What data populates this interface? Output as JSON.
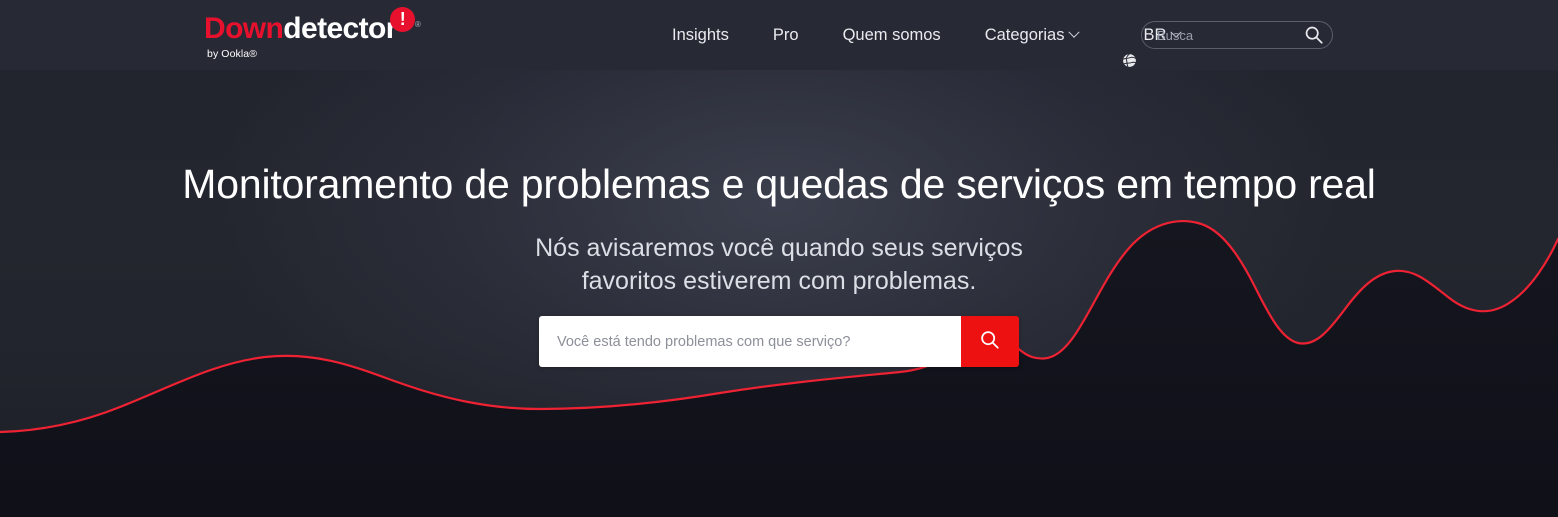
{
  "header": {
    "logo": {
      "word_one": "Down",
      "word_two": "detector",
      "badge_glyph": "!",
      "registered_mark": "®",
      "tagline": "by Ookla®"
    },
    "nav": [
      {
        "label": "Insights",
        "has_chevron": false,
        "has_globe": false
      },
      {
        "label": "Pro",
        "has_chevron": false,
        "has_globe": false
      },
      {
        "label": "Quem somos",
        "has_chevron": false,
        "has_globe": false
      },
      {
        "label": "Categorias",
        "has_chevron": true,
        "has_globe": false
      },
      {
        "label": "BR",
        "has_chevron": true,
        "has_globe": true
      }
    ],
    "search": {
      "value": "",
      "placeholder": "Busca",
      "icon": "search-icon"
    }
  },
  "hero": {
    "title": "Monitoramento de problemas e quedas de serviços em tempo real",
    "subtitle_line_1": "Nós avisaremos você quando seus serviços",
    "subtitle_line_2": "favoritos estiverem com problemas.",
    "search": {
      "value": "",
      "placeholder": "Você está tendo problemas com que serviço?",
      "button_icon": "search-icon"
    }
  },
  "colors": {
    "brand_red": "#e8112d",
    "button_red": "#ee1111",
    "header_bg": "#272a35",
    "hero_bg": "#22242e",
    "wave_stroke": "#ee2233",
    "wave_fill": "#141620",
    "text_primary": "#ffffff",
    "text_secondary": "#dcdee6"
  }
}
